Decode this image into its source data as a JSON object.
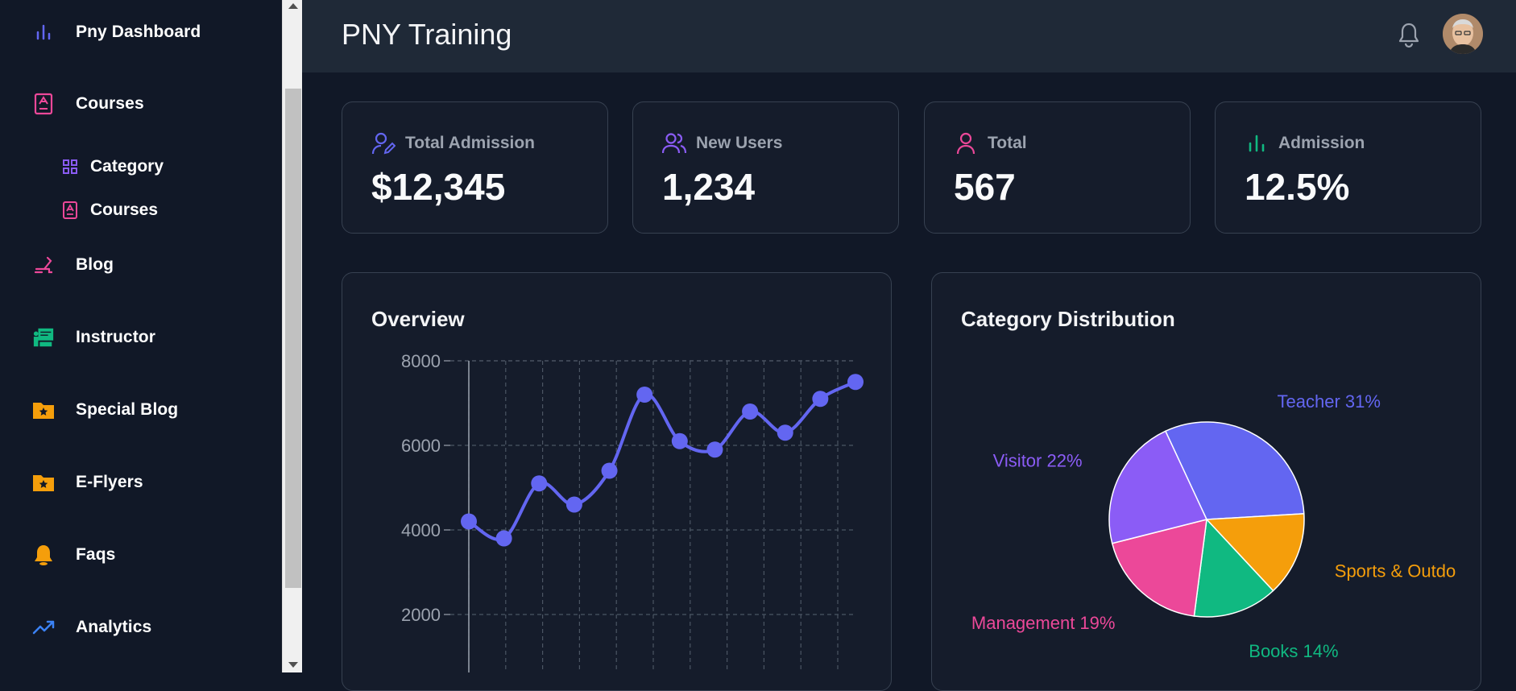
{
  "sidebar": {
    "items": [
      {
        "label": "Pny Dashboard",
        "icon": "bar-chart-icon",
        "color": "#6366f1"
      },
      {
        "label": "Courses",
        "icon": "book-icon",
        "color": "#ec4899"
      },
      {
        "label": "Category",
        "icon": "grid-icon",
        "color": "#8b5cf6"
      },
      {
        "label": "Courses",
        "icon": "book-icon",
        "color": "#ec4899"
      },
      {
        "label": "Blog",
        "icon": "pen-icon",
        "color": "#ec4899"
      },
      {
        "label": "Instructor",
        "icon": "teacher-icon",
        "color": "#10b981"
      },
      {
        "label": "Special Blog",
        "icon": "folder-star-icon",
        "color": "#f59e0b"
      },
      {
        "label": "E-Flyers",
        "icon": "folder-star-icon",
        "color": "#f59e0b"
      },
      {
        "label": "Faqs",
        "icon": "bell-alt-icon",
        "color": "#f59e0b"
      },
      {
        "label": "Analytics",
        "icon": "trending-up-icon",
        "color": "#3b82f6"
      }
    ]
  },
  "header": {
    "title": "PNY Training"
  },
  "stats": [
    {
      "label": "Total Admission",
      "value": "$12,345",
      "icon": "user-pen-icon",
      "color": "#6366f1"
    },
    {
      "label": "New Users",
      "value": "1,234",
      "icon": "users-icon",
      "color": "#8b5cf6"
    },
    {
      "label": "Total",
      "value": "567",
      "icon": "user-icon",
      "color": "#ec4899"
    },
    {
      "label": "Admission",
      "value": "12.5%",
      "icon": "bar-chart-icon",
      "color": "#10b981"
    }
  ],
  "overview": {
    "title": "Overview"
  },
  "distribution": {
    "title": "Category Distribution"
  },
  "chart_data": [
    {
      "type": "line",
      "title": "Overview",
      "xlabel": "",
      "ylabel": "",
      "y_ticks": [
        "2000",
        "4000",
        "6000",
        "8000"
      ],
      "ylim": [
        0,
        8000
      ],
      "grid": true,
      "color": "#6366f1",
      "series": [
        {
          "values": [
            4200,
            3800,
            5100,
            4600,
            5400,
            7200,
            6100,
            5900,
            6800,
            6300,
            7100,
            7500
          ]
        }
      ]
    },
    {
      "type": "pie",
      "title": "Category Distribution",
      "slices": [
        {
          "label": "Teacher 31%",
          "value": 31,
          "color": "#6366f1"
        },
        {
          "label": "Sports & Outdo",
          "value": 14,
          "color": "#f59e0b"
        },
        {
          "label": "Books 14%",
          "value": 14,
          "color": "#10b981"
        },
        {
          "label": "Management 19%",
          "value": 19,
          "color": "#ec4899"
        },
        {
          "label": "Visitor 22%",
          "value": 22,
          "color": "#8b5cf6"
        }
      ]
    }
  ]
}
